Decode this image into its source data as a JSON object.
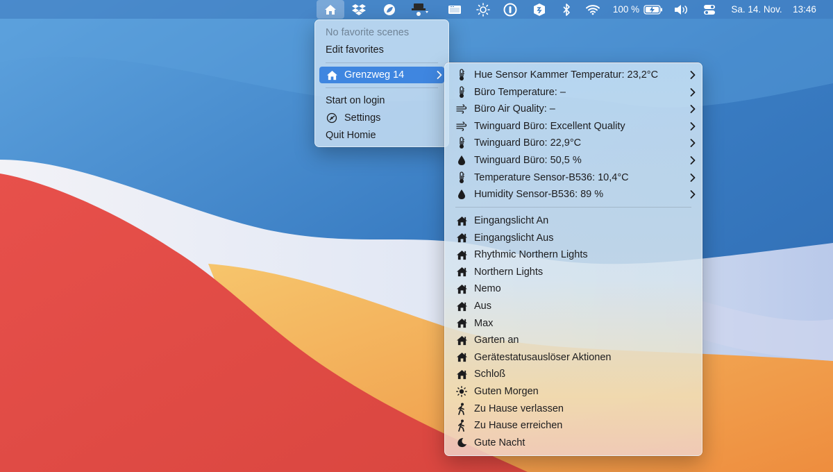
{
  "menubar": {
    "battery_percent": "100 %",
    "clock_date": "Sa. 14. Nov.",
    "clock_time": "13:46",
    "icons": [
      "home-icon",
      "dropbox-icon",
      "leaf-icon",
      "hat-icon",
      "window-icon",
      "brightness-icon",
      "password-icon",
      "shield-icon",
      "bluetooth-icon",
      "wifi-icon",
      "battery-icon",
      "volume-icon",
      "control-center-icon"
    ]
  },
  "main_menu": {
    "no_favorites": "No favorite scenes",
    "edit_favorites": "Edit favorites",
    "home_name": "Grenzweg 14",
    "start_on_login": "Start on login",
    "settings": "Settings",
    "quit": "Quit Homie"
  },
  "sensors": [
    {
      "icon": "thermometer-icon",
      "label": "Hue Sensor Kammer Temperatur: 23,2°C"
    },
    {
      "icon": "thermometer-icon",
      "label": "Büro Temperature: –"
    },
    {
      "icon": "air-quality-icon",
      "label": "Büro Air Quality: –"
    },
    {
      "icon": "air-quality-icon",
      "label": "Twinguard Büro: Excellent Quality"
    },
    {
      "icon": "thermometer-icon",
      "label": "Twinguard Büro: 22,9°C"
    },
    {
      "icon": "droplet-icon",
      "label": "Twinguard Büro: 50,5 %"
    },
    {
      "icon": "thermometer-icon",
      "label": "Temperature Sensor-B536: 10,4°C"
    },
    {
      "icon": "droplet-icon",
      "label": "Humidity Sensor-B536: 89 %"
    }
  ],
  "scenes": [
    {
      "icon": "home-icon",
      "label": "Eingangslicht An"
    },
    {
      "icon": "home-icon",
      "label": "Eingangslicht Aus"
    },
    {
      "icon": "home-icon",
      "label": "Rhythmic Northern Lights"
    },
    {
      "icon": "home-icon",
      "label": "Northern Lights"
    },
    {
      "icon": "home-icon",
      "label": "Nemo"
    },
    {
      "icon": "home-icon",
      "label": "Aus"
    },
    {
      "icon": "home-icon",
      "label": "Max"
    },
    {
      "icon": "home-icon",
      "label": "Garten an"
    },
    {
      "icon": "home-icon",
      "label": "Gerätestatusauslöser Aktionen"
    },
    {
      "icon": "home-icon",
      "label": "Schloß"
    },
    {
      "icon": "sun-icon",
      "label": "Guten Morgen"
    },
    {
      "icon": "walking-icon",
      "label": "Zu Hause verlassen"
    },
    {
      "icon": "walking-icon",
      "label": "Zu Hause erreichen"
    },
    {
      "icon": "moon-icon",
      "label": "Gute Nacht"
    }
  ],
  "colors": {
    "selection": "#3f86e0",
    "wallpaper_blue": "#3b7fc4",
    "wallpaper_red": "#e4544f",
    "wallpaper_orange": "#f0a24a"
  }
}
